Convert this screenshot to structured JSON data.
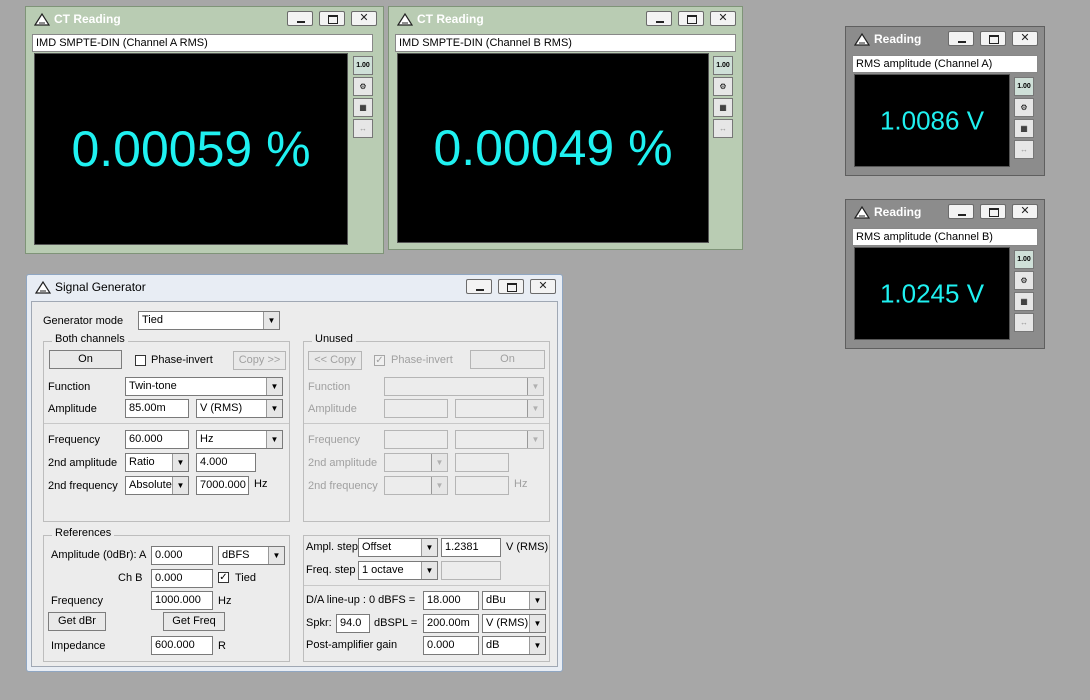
{
  "ct_a": {
    "title": "CT Reading",
    "subtitle": "IMD SMPTE-DIN (Channel A RMS)",
    "value": "0.00059 %"
  },
  "ct_b": {
    "title": "CT Reading",
    "subtitle": "IMD SMPTE-DIN (Channel B RMS)",
    "value": "0.00049 %"
  },
  "rd_a": {
    "title": "Reading",
    "subtitle": "RMS amplitude (Channel A)",
    "value": "1.0086 V"
  },
  "rd_b": {
    "title": "Reading",
    "subtitle": "RMS amplitude (Channel B)",
    "value": "1.0245 V"
  },
  "meter_badge": "1.00",
  "sg": {
    "title": "Signal Generator",
    "mode_label": "Generator mode",
    "mode_value": "Tied",
    "both": {
      "title": "Both channels",
      "on": "On",
      "phase_invert": "Phase-invert",
      "copy": "Copy >>",
      "function_label": "Function",
      "function_value": "Twin-tone",
      "amplitude_label": "Amplitude",
      "amplitude_value": "85.00m",
      "amplitude_unit": "V (RMS)",
      "frequency_label": "Frequency",
      "frequency_value": "60.000",
      "frequency_unit": "Hz",
      "amp2_label": "2nd amplitude",
      "amp2_mode": "Ratio",
      "amp2_value": "4.000",
      "freq2_label": "2nd frequency",
      "freq2_mode": "Absolute",
      "freq2_value": "7000.000",
      "freq2_unit": "Hz"
    },
    "unused": {
      "title": "Unused",
      "copy": "<< Copy",
      "phase_invert": "Phase-invert",
      "on": "On",
      "function_label": "Function",
      "amplitude_label": "Amplitude",
      "frequency_label": "Frequency",
      "amp2_label": "2nd amplitude",
      "freq2_label": "2nd frequency",
      "freq2_unit": "Hz"
    },
    "refs": {
      "title": "References",
      "amp_label": "Amplitude (0dBr): A",
      "amp_a_value": "0.000",
      "amp_a_unit": "dBFS",
      "chb_label": "Ch B",
      "chb_value": "0.000",
      "tied": "Tied",
      "freq_label": "Frequency",
      "freq_value": "1000.000",
      "freq_unit": "Hz",
      "get_dbr": "Get dBr",
      "get_freq": "Get Freq",
      "imp_label": "Impedance",
      "imp_value": "600.000",
      "imp_unit": "R"
    },
    "steps": {
      "ampl_label": "Ampl. step",
      "ampl_mode": "Offset",
      "ampl_value": "1.2381",
      "ampl_unit": "V (RMS)",
      "freq_label": "Freq. step",
      "freq_value": "1 octave"
    },
    "da": {
      "lineup_label": "D/A line-up : 0 dBFS =",
      "lineup_value": "18.000",
      "lineup_unit": "dBu",
      "spkr_label": "Spkr:",
      "spkr_value": "94.0",
      "dbspl_label": "dBSPL =",
      "dbspl_value": "200.00m",
      "dbspl_unit": "V (RMS)",
      "postamp_label": "Post-amplifier gain",
      "postamp_value": "0.000",
      "postamp_unit": "dB"
    }
  }
}
